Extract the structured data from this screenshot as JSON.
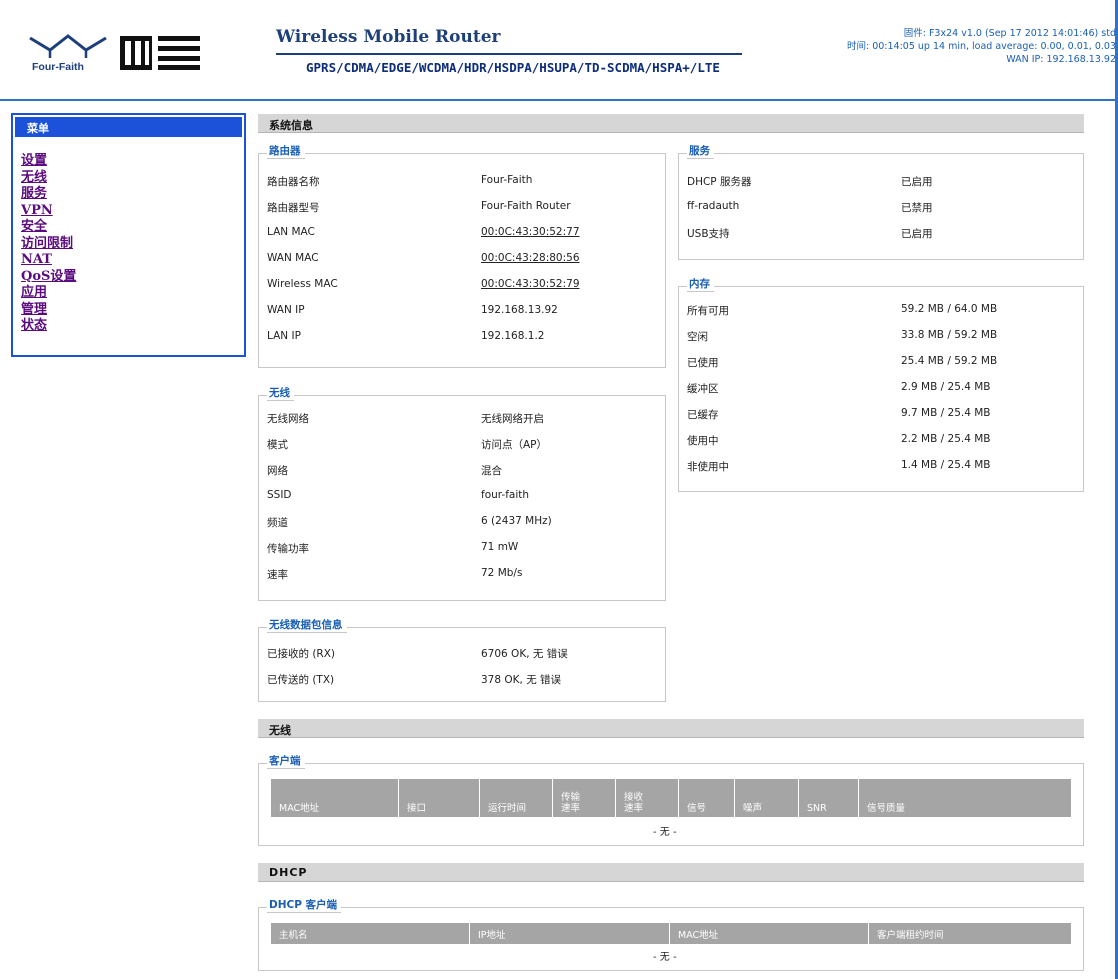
{
  "header": {
    "logo_text": "Four-Faith",
    "title": "Wireless Mobile Router",
    "subtitle": "GPRS/CDMA/EDGE/WCDMA/HDR/HSDPA/HSUPA/TD-SCDMA/HSPA+/LTE",
    "firmware": "固件: F3x24 v1.0 (Sep 17 2012 14:01:46) std",
    "time": "时间: 00:14:05 up 14 min, load average: 0.00, 0.01, 0.03",
    "wan_ip": "WAN IP: 192.168.13.92"
  },
  "menu": {
    "title": "菜单",
    "items": [
      "设置",
      "无线",
      "服务",
      "VPN",
      "安全",
      "访问限制",
      "NAT",
      "QoS设置",
      "应用",
      "管理",
      "状态"
    ]
  },
  "system_info": {
    "title": "系统信息",
    "router": {
      "legend": "路由器",
      "rows": [
        {
          "label": "路由器名称",
          "value": "Four-Faith"
        },
        {
          "label": "路由器型号",
          "value": "Four-Faith Router"
        },
        {
          "label": "LAN MAC",
          "value": "00:0C:43:30:52:77"
        },
        {
          "label": "WAN MAC",
          "value": "00:0C:43:28:80:56"
        },
        {
          "label": "Wireless MAC",
          "value": "00:0C:43:30:52:79"
        },
        {
          "label": "WAN IP",
          "value": "192.168.13.92"
        },
        {
          "label": "LAN IP",
          "value": "192.168.1.2"
        }
      ]
    },
    "services": {
      "legend": "服务",
      "rows": [
        {
          "label": "DHCP 服务器",
          "value": "已启用"
        },
        {
          "label": "ff-radauth",
          "value": "已禁用"
        },
        {
          "label": "USB支持",
          "value": "已启用"
        }
      ]
    },
    "memory": {
      "legend": "内存",
      "rows": [
        {
          "label": "所有可用",
          "value": "59.2 MB / 64.0 MB"
        },
        {
          "label": "空闲",
          "value": "33.8 MB / 59.2 MB"
        },
        {
          "label": "已使用",
          "value": "25.4 MB / 59.2 MB"
        },
        {
          "label": "缓冲区",
          "value": "2.9 MB / 25.4 MB"
        },
        {
          "label": "已缓存",
          "value": "9.7 MB / 25.4 MB"
        },
        {
          "label": "使用中",
          "value": "2.2 MB / 25.4 MB"
        },
        {
          "label": "非使用中",
          "value": "1.4 MB / 25.4 MB"
        }
      ]
    },
    "wireless": {
      "legend": "无线",
      "rows": [
        {
          "label": "无线网络",
          "value": "无线网络开启"
        },
        {
          "label": "模式",
          "value": "访问点（AP）"
        },
        {
          "label": "网络",
          "value": "混合"
        },
        {
          "label": "SSID",
          "value": "four-faith"
        },
        {
          "label": "频道",
          "value": "6 (2437 MHz)"
        },
        {
          "label": "传输功率",
          "value": "71 mW"
        },
        {
          "label": "速率",
          "value": "72 Mb/s"
        }
      ]
    },
    "packets": {
      "legend": "无线数据包信息",
      "rows": [
        {
          "label": "已接收的 (RX)",
          "value": "6706 OK, 无 错误"
        },
        {
          "label": "已传送的 (TX)",
          "value": "378 OK, 无 错误"
        }
      ]
    }
  },
  "wireless_section": {
    "title": "无线",
    "clients": {
      "legend": "客户端",
      "columns": [
        "MAC地址",
        "接口",
        "运行时间",
        "传输\n速率",
        "接收\n速率",
        "信号",
        "噪声",
        "SNR",
        "信号质量"
      ],
      "empty": "- 无 -"
    }
  },
  "dhcp_section": {
    "title": "DHCP",
    "clients": {
      "legend": "DHCP 客户端",
      "columns": [
        "主机名",
        "IP地址",
        "MAC地址",
        "客户端租约时间"
      ],
      "empty": "- 无 -"
    }
  }
}
